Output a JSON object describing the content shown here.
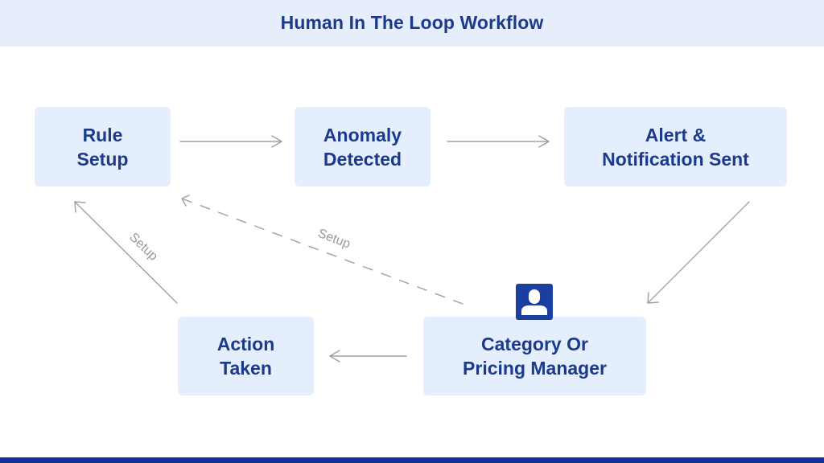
{
  "header": {
    "title": "Human In The Loop Workflow"
  },
  "colors": {
    "header_bg": "#e6eefb",
    "node_bg": "#e5eefc",
    "node_text": "#1b3a8c",
    "arrow": "#a0a0a0",
    "footer_bar": "#15309a",
    "icon": "#1b3fa0"
  },
  "nodes": [
    {
      "id": "rule-setup",
      "lines": [
        "Rule",
        "Setup"
      ]
    },
    {
      "id": "anomaly-detected",
      "lines": [
        "Anomaly",
        "Detected"
      ]
    },
    {
      "id": "alert-notification",
      "lines": [
        "Alert &",
        "Notification Sent"
      ]
    },
    {
      "id": "category-pricing-manager",
      "lines": [
        "Category Or",
        "Pricing Manager"
      ],
      "icon": "user-icon"
    },
    {
      "id": "action-taken",
      "lines": [
        "Action",
        "Taken"
      ]
    }
  ],
  "edges": [
    {
      "from": "rule-setup",
      "to": "anomaly-detected",
      "style": "solid",
      "label": ""
    },
    {
      "from": "anomaly-detected",
      "to": "alert-notification",
      "style": "solid",
      "label": ""
    },
    {
      "from": "alert-notification",
      "to": "category-pricing-manager",
      "style": "solid",
      "label": ""
    },
    {
      "from": "category-pricing-manager",
      "to": "action-taken",
      "style": "solid",
      "label": ""
    },
    {
      "from": "action-taken",
      "to": "rule-setup",
      "style": "solid",
      "label": "Setup"
    },
    {
      "from": "category-pricing-manager",
      "to": "rule-setup",
      "style": "dashed",
      "label": "Setup"
    }
  ]
}
